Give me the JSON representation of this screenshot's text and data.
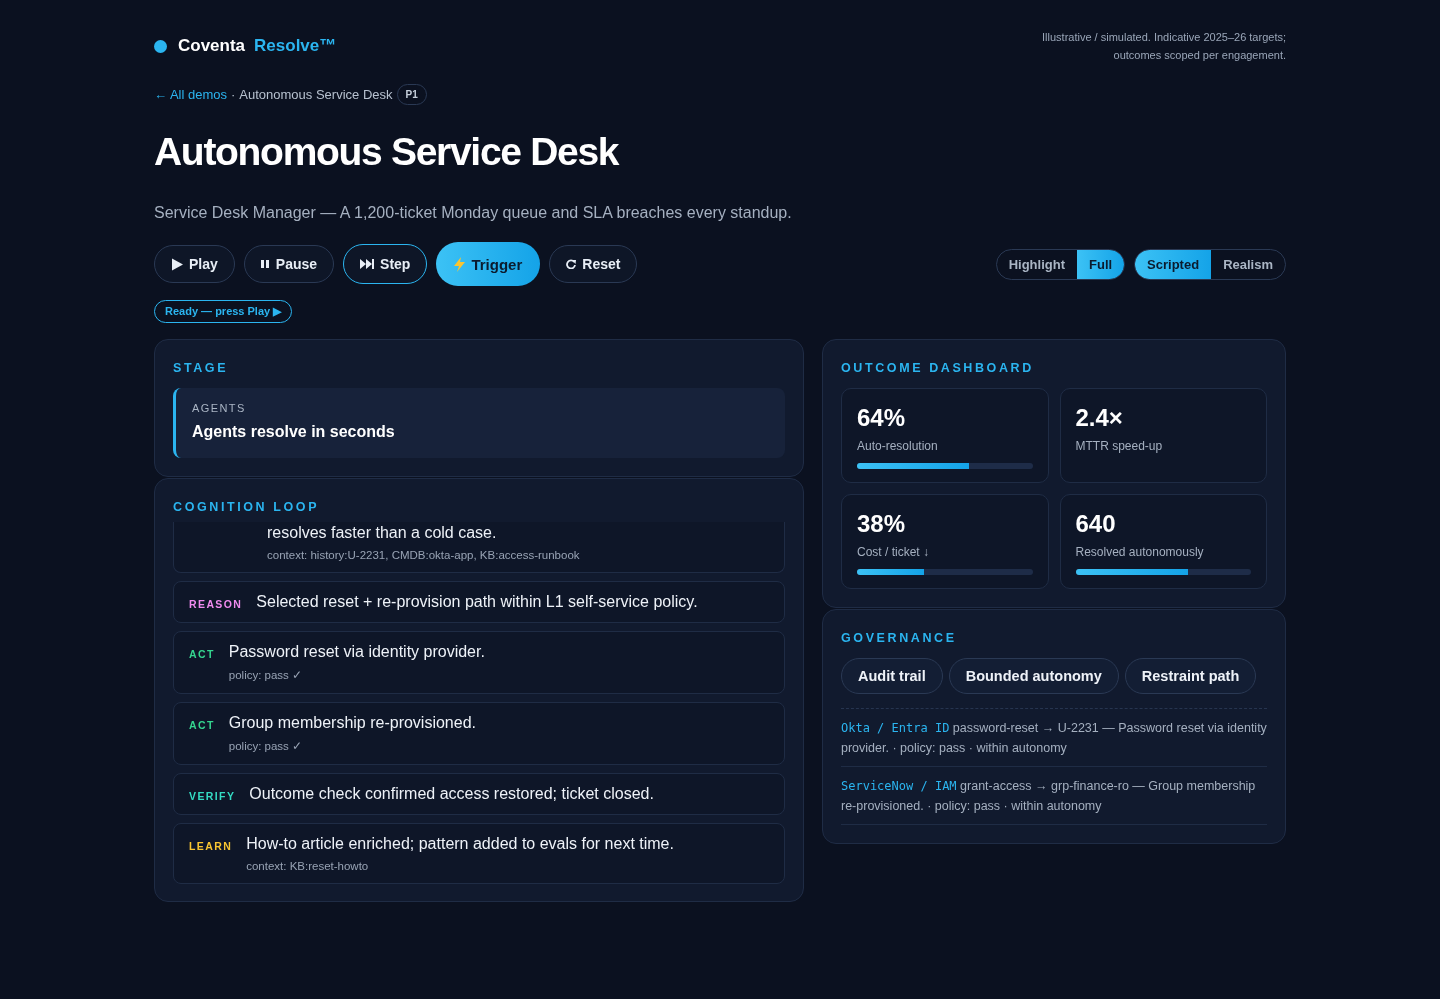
{
  "brand": {
    "name": "Coventa",
    "product": "Resolve™"
  },
  "disclaimer": "Illustrative / simulated. Indicative 2025–26 targets; outcomes scoped per engagement.",
  "breadcrumb": {
    "back_link": "← All demos",
    "separator": "·",
    "current": "Autonomous Service Desk",
    "badge": "P1"
  },
  "title": "Autonomous Service Desk",
  "subtitle": "Service Desk Manager — A 1,200-ticket Monday queue and SLA breaches every standup.",
  "controls": [
    {
      "label": "Play",
      "kind": "play"
    },
    {
      "label": "Pause",
      "kind": "pause"
    },
    {
      "label": "Step",
      "kind": "step"
    },
    {
      "label": "Trigger",
      "kind": "trigger"
    },
    {
      "label": "Reset",
      "kind": "reset"
    }
  ],
  "view_toggle": [
    {
      "label": "Highlight",
      "selected": false
    },
    {
      "label": "Full",
      "selected": true
    }
  ],
  "mode_toggle": [
    {
      "label": "Scripted",
      "selected": true
    },
    {
      "label": "Realism",
      "selected": false
    }
  ],
  "status": "Ready — press Play ▶",
  "stage": {
    "heading": "STAGE",
    "label": "AGENTS",
    "text": "Agents resolve in seconds"
  },
  "cognition_loop": {
    "heading": "COGNITION LOOP",
    "items": [
      {
        "kind": "partial",
        "text": "resolves faster than a cold case.",
        "detail": "context: history:U-2231, CMDB:okta-app, KB:access-runbook"
      },
      {
        "kind": "reason",
        "label": "REASON",
        "text": "Selected reset + re-provision path within L1 self-service policy."
      },
      {
        "kind": "act",
        "label": "ACT",
        "text": "Password reset via identity provider.",
        "detail": "policy: pass ✓"
      },
      {
        "kind": "act",
        "label": "ACT",
        "text": "Group membership re-provisioned.",
        "detail": "policy: pass ✓"
      },
      {
        "kind": "verify",
        "label": "VERIFY",
        "text": "Outcome check confirmed access restored; ticket closed."
      },
      {
        "kind": "learn",
        "label": "LEARN",
        "text": "How-to article enriched; pattern added to evals for next time.",
        "detail": "context: KB:reset-howto"
      }
    ]
  },
  "outcome_dashboard": {
    "heading": "OUTCOME DASHBOARD",
    "metrics": [
      {
        "value": "64%",
        "label": "Auto-resolution",
        "level": 0.64
      },
      {
        "value": "2.4×",
        "label": "MTTR speed-up"
      },
      {
        "value": "38%",
        "label": "Cost / ticket ↓",
        "level": 0.38
      },
      {
        "value": "640",
        "label": "Resolved autonomously",
        "level": 0.64
      }
    ]
  },
  "governance": {
    "heading": "GOVERNANCE",
    "chips": [
      "Audit trail",
      "Bounded autonomy",
      "Restraint path"
    ],
    "log": [
      {
        "source": "Okta / Entra ID",
        "text": "password-reset → U-2231 — Password reset via identity provider. · policy: pass · within autonomy"
      },
      {
        "source": "ServiceNow / IAM",
        "text": "grant-access → grp-finance-ro — Group membership re-provisioned. · policy: pass · within autonomy"
      }
    ]
  }
}
